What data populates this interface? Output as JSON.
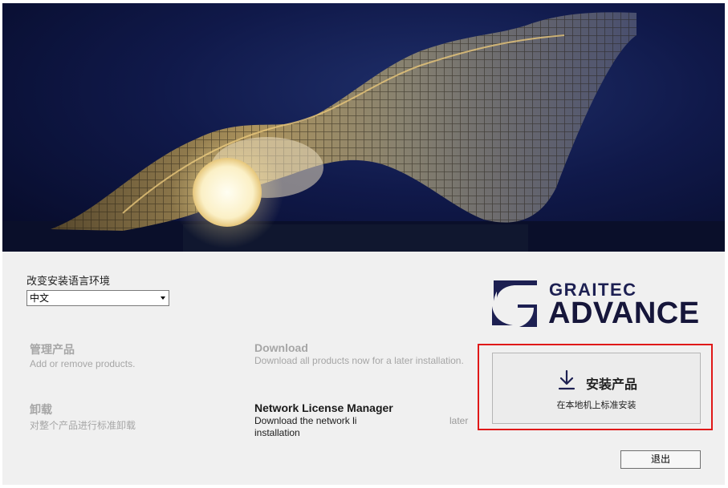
{
  "language": {
    "label": "改变安装语言环境",
    "selected": "中文"
  },
  "options": {
    "manage": {
      "title": "管理产品",
      "desc": "Add or remove products."
    },
    "download": {
      "title": "Download",
      "desc": "Download all products now for a later installation."
    },
    "uninstall": {
      "title": "卸载",
      "desc": "对整个产品进行标准卸载"
    },
    "nlm": {
      "title": "Network License Manager",
      "desc_line1": "Download the network li",
      "desc_line1_tail": "later",
      "desc_line2": "installation"
    }
  },
  "logo": {
    "graitec": "GRAITEC",
    "advance": "ADVANCE"
  },
  "install": {
    "title": "安装产品",
    "subtitle": "在本地机上标准安装"
  },
  "exit_label": "退出",
  "colors": {
    "highlight_border": "#e01818",
    "logo_navy": "#1d2052",
    "disabled_text": "#a6a6a6"
  }
}
